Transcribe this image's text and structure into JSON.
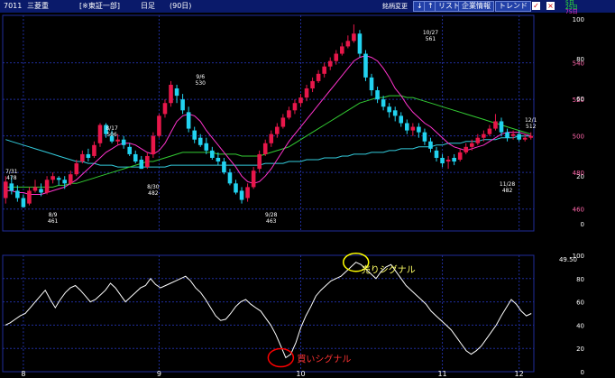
{
  "topbar": {
    "code": "7011",
    "name": "三菱重",
    "market": "[※東証一部]",
    "period": "日足",
    "days": "(90日)",
    "stock_change_label": "銘柄変更",
    "down_arrow": "↓",
    "up_arrow": "↑",
    "list_button": "リスト",
    "company_info_button": "企業情報",
    "trend_button": "トレンド",
    "mini_legend": [
      "5日",
      "25日",
      "75日"
    ],
    "close_x": "×",
    "check": "✓"
  },
  "colors": {
    "background": "#000000",
    "grid": "#1f2d9a",
    "bull_candle": "#e8174a",
    "bear_candle": "#22d3f0",
    "ma5": "#ff33cc",
    "ma25": "#33cc33",
    "ma75": "#33ccdd",
    "indicator": "#ffffff",
    "buy_circle": "#ff0000",
    "sell_circle": "#ffff00",
    "buy_text": "#ff3333",
    "sell_text": "#ffff66",
    "annotation_text": "#ffffff",
    "pink_tick": "#ff66aa"
  },
  "price_axis_labels": [
    {
      "label": "100",
      "style": "white"
    },
    {
      "label": "540",
      "style": "pink"
    },
    {
      "label": "80",
      "style": "white"
    },
    {
      "label": "520",
      "style": "pink"
    },
    {
      "label": "60",
      "style": "white"
    },
    {
      "label": "500",
      "style": "pink"
    },
    {
      "label": "20",
      "style": "white"
    },
    {
      "label": "480",
      "style": "pink"
    },
    {
      "label": "460",
      "style": "pink"
    },
    {
      "label": "0",
      "style": "white"
    }
  ],
  "indicator_axis_labels": [
    "100",
    "80",
    "60",
    "40",
    "20",
    "0"
  ],
  "indicator_value_label": "49.50",
  "x_axis_labels": [
    "8",
    "9",
    "10",
    "11",
    "12"
  ],
  "price_annotations": [
    {
      "date": "7/31",
      "price": "478"
    },
    {
      "date": "8/9",
      "price": "461"
    },
    {
      "date": "8/17",
      "price": "506"
    },
    {
      "date": "8/30",
      "price": "482"
    },
    {
      "date": "9/6",
      "price": "530"
    },
    {
      "date": "9/28",
      "price": "463"
    },
    {
      "date": "10/27",
      "price": "561"
    },
    {
      "date": "11/28",
      "price": "482"
    },
    {
      "date": "12/1",
      "price": "512"
    }
  ],
  "signals": {
    "buy_label": "買いシグナル",
    "sell_label": "売りシグナル"
  },
  "chart_data": [
    {
      "type": "candlestick",
      "title": "7011 三菱重 日足 (90日)",
      "x_labels": [
        "8",
        "9",
        "10",
        "11",
        "12"
      ],
      "y_ticks": [
        460,
        480,
        500,
        520,
        540
      ],
      "ylim": [
        448,
        566
      ],
      "candles": [
        [
          466,
          475,
          478,
          463
        ],
        [
          474,
          470,
          478,
          468
        ],
        [
          470,
          466,
          473,
          464
        ],
        [
          466,
          461,
          468,
          461
        ],
        [
          463,
          470,
          472,
          462
        ],
        [
          470,
          472,
          476,
          469
        ],
        [
          471,
          469,
          474,
          467
        ],
        [
          469,
          476,
          478,
          468
        ],
        [
          476,
          478,
          480,
          474
        ],
        [
          477,
          476,
          478,
          473
        ],
        [
          476,
          474,
          478,
          471
        ],
        [
          474,
          479,
          481,
          473
        ],
        [
          479,
          485,
          487,
          478
        ],
        [
          486,
          490,
          492,
          485
        ],
        [
          490,
          488,
          493,
          486
        ],
        [
          489,
          495,
          497,
          488
        ],
        [
          496,
          506,
          507,
          494
        ],
        [
          506,
          501,
          507,
          499
        ],
        [
          500,
          497,
          503,
          496
        ],
        [
          497,
          498,
          501,
          495
        ],
        [
          498,
          495,
          500,
          493
        ],
        [
          494,
          490,
          496,
          489
        ],
        [
          490,
          486,
          492,
          485
        ],
        [
          487,
          482,
          489,
          482
        ],
        [
          483,
          489,
          491,
          482
        ],
        [
          490,
          500,
          502,
          488
        ],
        [
          500,
          511,
          512,
          499
        ],
        [
          512,
          518,
          520,
          510
        ],
        [
          518,
          528,
          530,
          516
        ],
        [
          526,
          522,
          528,
          518
        ],
        [
          520,
          514,
          523,
          512
        ],
        [
          513,
          504,
          516,
          502
        ],
        [
          503,
          498,
          505,
          496
        ],
        [
          499,
          495,
          501,
          494
        ],
        [
          496,
          492,
          499,
          490
        ],
        [
          492,
          488,
          494,
          487
        ],
        [
          488,
          486,
          491,
          484
        ],
        [
          486,
          480,
          488,
          479
        ],
        [
          480,
          474,
          482,
          473
        ],
        [
          474,
          469,
          476,
          468
        ],
        [
          470,
          465,
          472,
          463
        ],
        [
          466,
          472,
          474,
          464
        ],
        [
          472,
          481,
          483,
          471
        ],
        [
          482,
          490,
          492,
          480
        ],
        [
          490,
          496,
          498,
          489
        ],
        [
          496,
          501,
          503,
          494
        ],
        [
          501,
          505,
          507,
          499
        ],
        [
          505,
          510,
          512,
          504
        ],
        [
          510,
          514,
          516,
          509
        ],
        [
          514,
          518,
          520,
          512
        ],
        [
          518,
          521,
          523,
          516
        ],
        [
          521,
          526,
          528,
          519
        ],
        [
          526,
          530,
          532,
          524
        ],
        [
          530,
          534,
          536,
          529
        ],
        [
          534,
          538,
          540,
          532
        ],
        [
          538,
          541,
          543,
          536
        ],
        [
          541,
          545,
          547,
          539
        ],
        [
          545,
          549,
          551,
          544
        ],
        [
          549,
          552,
          555,
          548
        ],
        [
          552,
          556,
          561,
          551
        ],
        [
          556,
          545,
          558,
          543
        ],
        [
          545,
          532,
          547,
          530
        ],
        [
          532,
          525,
          534,
          522
        ],
        [
          525,
          520,
          527,
          518
        ],
        [
          520,
          516,
          522,
          514
        ],
        [
          516,
          513,
          518,
          510
        ],
        [
          514,
          511,
          516,
          508
        ],
        [
          511,
          507,
          513,
          505
        ],
        [
          507,
          503,
          509,
          501
        ],
        [
          503,
          505,
          507,
          500
        ],
        [
          505,
          502,
          507,
          499
        ],
        [
          502,
          497,
          504,
          495
        ],
        [
          497,
          493,
          499,
          491
        ],
        [
          492,
          488,
          494,
          486
        ],
        [
          488,
          485,
          490,
          483
        ],
        [
          486,
          487,
          489,
          482
        ],
        [
          488,
          486,
          490,
          484
        ],
        [
          487,
          491,
          493,
          486
        ],
        [
          491,
          494,
          496,
          490
        ],
        [
          494,
          496,
          498,
          492
        ],
        [
          496,
          499,
          501,
          495
        ],
        [
          499,
          501,
          503,
          497
        ],
        [
          501,
          504,
          506,
          500
        ],
        [
          504,
          508,
          512,
          503
        ],
        [
          508,
          502,
          510,
          500
        ],
        [
          502,
          499,
          504,
          497
        ],
        [
          500,
          501,
          503,
          498
        ],
        [
          501,
          498,
          503,
          497
        ],
        [
          498,
          499,
          501,
          497
        ],
        [
          499,
          500,
          502,
          498
        ]
      ],
      "moving_averages": {
        "ma5": [
          470,
          470,
          469,
          469,
          468,
          468,
          468,
          469,
          470,
          471,
          472,
          474,
          476,
          479,
          482,
          485,
          488,
          491,
          493,
          495,
          496,
          496,
          495,
          493,
          491,
          490,
          492,
          496,
          502,
          508,
          511,
          512,
          511,
          508,
          503,
          499,
          495,
          491,
          487,
          483,
          478,
          475,
          474,
          475,
          478,
          482,
          487,
          492,
          497,
          501,
          505,
          509,
          513,
          517,
          521,
          525,
          529,
          533,
          537,
          541,
          543,
          544,
          543,
          541,
          537,
          532,
          526,
          522,
          517,
          513,
          510,
          507,
          505,
          502,
          499,
          496,
          494,
          493,
          492,
          493,
          494,
          495,
          497,
          499,
          501,
          502,
          502,
          502,
          501,
          500
        ],
        "ma25": [
          472,
          472,
          472,
          472,
          472,
          472,
          472,
          472,
          472,
          473,
          473,
          474,
          474,
          475,
          476,
          477,
          478,
          479,
          480,
          481,
          482,
          483,
          484,
          485,
          486,
          486,
          487,
          488,
          489,
          490,
          491,
          491,
          491,
          491,
          491,
          491,
          490,
          490,
          490,
          490,
          489,
          489,
          489,
          489,
          490,
          491,
          492,
          493,
          494,
          496,
          498,
          500,
          502,
          504,
          506,
          508,
          510,
          512,
          514,
          516,
          518,
          519,
          520,
          521,
          521,
          522,
          522,
          522,
          521,
          521,
          520,
          519,
          518,
          517,
          516,
          515,
          514,
          513,
          512,
          511,
          510,
          509,
          508,
          507,
          506,
          505,
          504,
          503,
          502,
          501
        ],
        "ma75": [
          498,
          497,
          496,
          495,
          494,
          493,
          492,
          491,
          490,
          489,
          488,
          487,
          486,
          486,
          485,
          485,
          484,
          484,
          484,
          483,
          483,
          483,
          483,
          483,
          483,
          483,
          483,
          483,
          484,
          484,
          484,
          484,
          484,
          484,
          484,
          484,
          484,
          484,
          484,
          484,
          484,
          484,
          484,
          484,
          485,
          485,
          485,
          485,
          486,
          486,
          486,
          487,
          487,
          487,
          488,
          488,
          488,
          489,
          489,
          490,
          490,
          490,
          491,
          491,
          491,
          492,
          492,
          493,
          493,
          493,
          494,
          494,
          494,
          495,
          495,
          496,
          496,
          496,
          497,
          497,
          497,
          498,
          498,
          498,
          499,
          499,
          499,
          500,
          500,
          500
        ]
      }
    },
    {
      "type": "line",
      "title": "",
      "ylim": [
        0,
        100
      ],
      "y_ticks": [
        0,
        20,
        40,
        60,
        80,
        100
      ],
      "series": [
        {
          "values": [
            40,
            42,
            45,
            48,
            50,
            55,
            60,
            65,
            70,
            62,
            55,
            62,
            68,
            72,
            74,
            70,
            65,
            60,
            62,
            66,
            70,
            76,
            72,
            66,
            60,
            64,
            68,
            72,
            74,
            80,
            75,
            72,
            74,
            76,
            78,
            80,
            82,
            78,
            72,
            68,
            62,
            55,
            48,
            44,
            45,
            50,
            56,
            60,
            62,
            58,
            55,
            52,
            46,
            40,
            32,
            22,
            12,
            15,
            25,
            38,
            48,
            56,
            65,
            70,
            74,
            78,
            80,
            82,
            86,
            90,
            94,
            92,
            88,
            84,
            80,
            86,
            90,
            92,
            86,
            80,
            74,
            70,
            66,
            62,
            58,
            52,
            48,
            44,
            40,
            36,
            30,
            24,
            18,
            15,
            18,
            22,
            28,
            34,
            40,
            48,
            55,
            62,
            58,
            52,
            48,
            50
          ]
        }
      ]
    }
  ]
}
